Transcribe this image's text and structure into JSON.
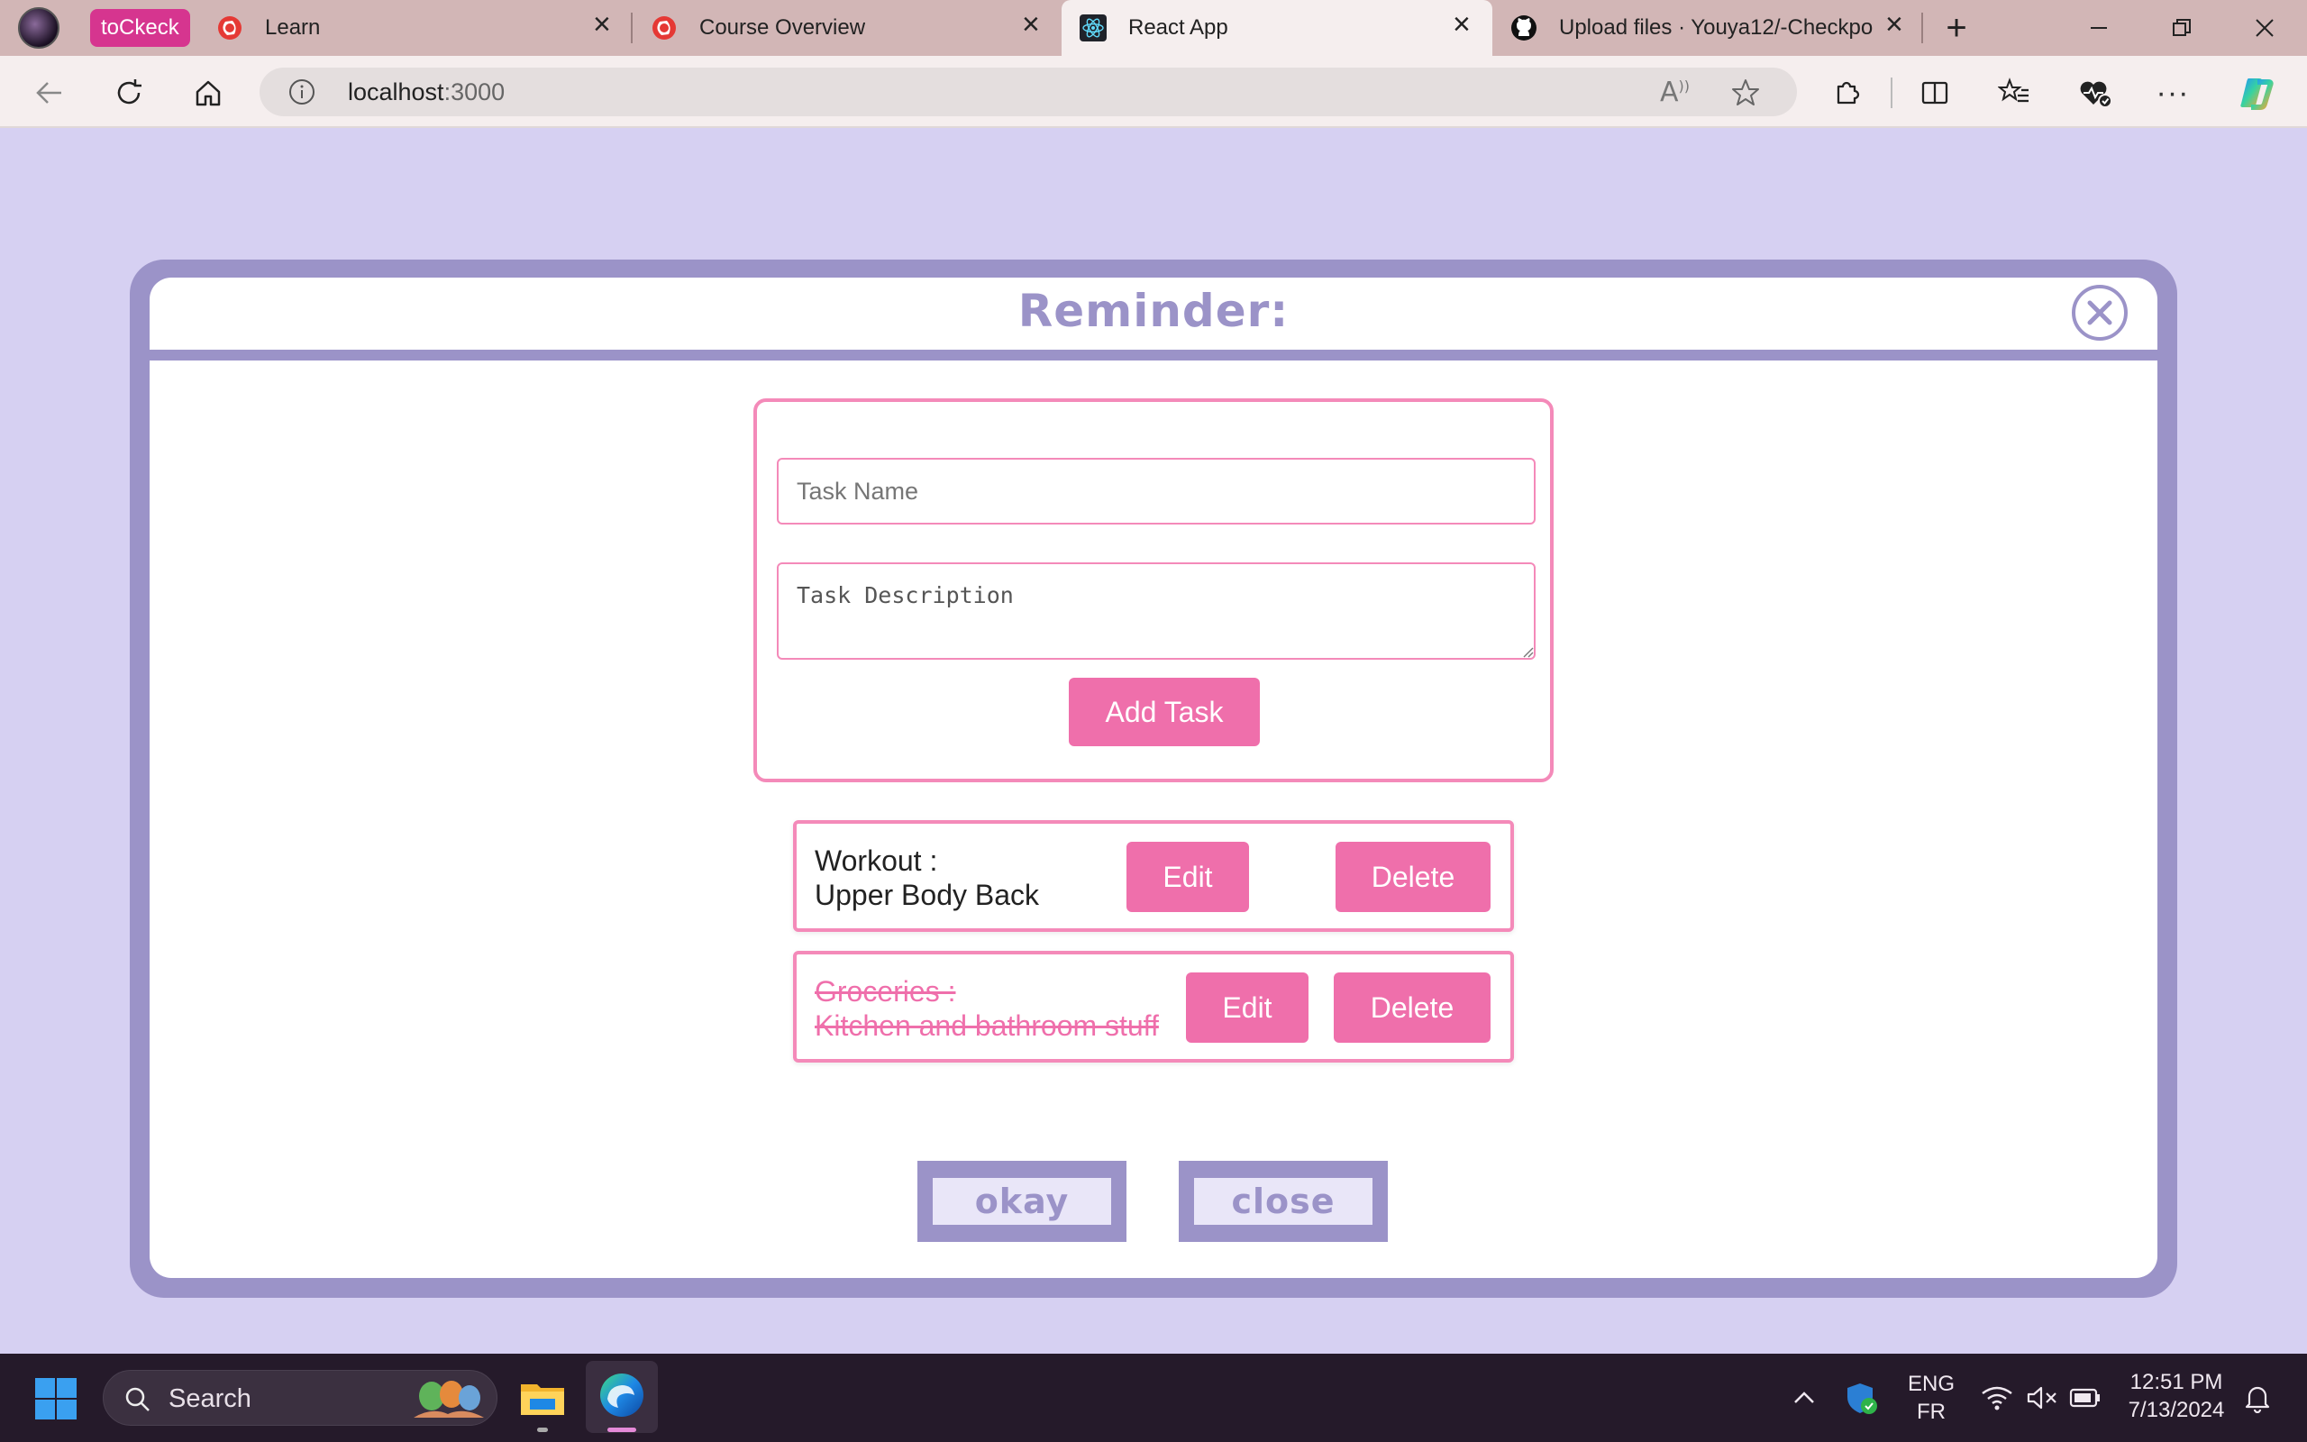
{
  "browser": {
    "tabs": [
      {
        "group_label": "toCkeck",
        "title": "Learn",
        "icon": "course-logo-icon"
      },
      {
        "title": "Course Overview",
        "icon": "course-logo-icon"
      },
      {
        "title": "React App",
        "icon": "react-icon",
        "active": true
      },
      {
        "title": "Upload files · Youya12/-Checkpo",
        "icon": "github-icon"
      }
    ],
    "address": {
      "host": "localhost",
      "port": ":3000"
    }
  },
  "app": {
    "title": "Reminder:",
    "form": {
      "name_placeholder": "Task Name",
      "description_placeholder": "Task Description",
      "add_label": "Add Task"
    },
    "tasks": [
      {
        "name": "Workout :",
        "description": "Upper Body Back",
        "completed": false,
        "edit_label": "Edit",
        "delete_label": "Delete"
      },
      {
        "name": "Groceries :",
        "description": "Kitchen and bathroom stuff",
        "completed": true,
        "edit_label": "Edit",
        "delete_label": "Delete"
      }
    ],
    "footer": {
      "okay_label": "okay",
      "close_label": "close"
    }
  },
  "taskbar": {
    "search_label": "Search",
    "language": {
      "primary": "ENG",
      "secondary": "FR"
    },
    "time": "12:51 PM",
    "date": "7/13/2024"
  },
  "colors": {
    "accent_pink": "#ef6fab",
    "accent_purple": "#9b93c8",
    "page_bg": "#d6d0f2"
  }
}
